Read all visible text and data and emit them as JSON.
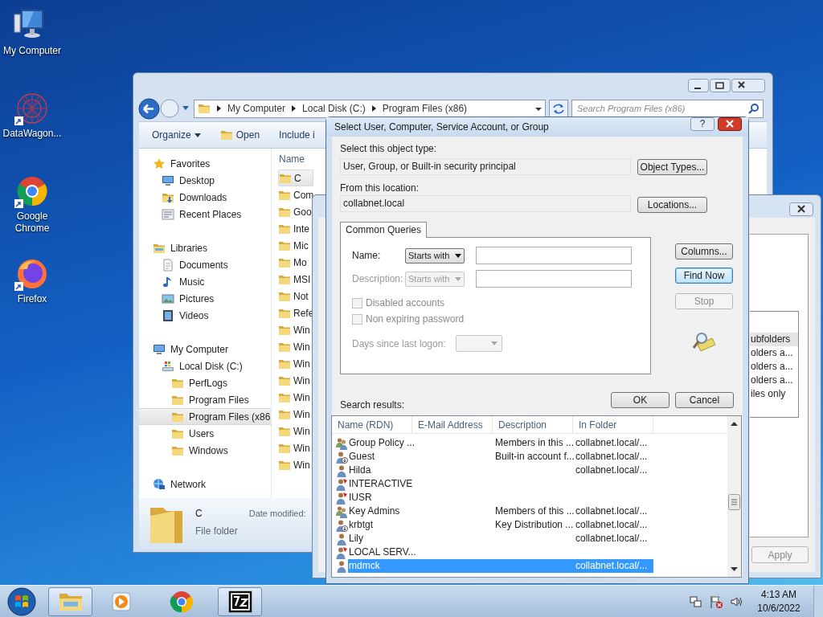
{
  "desktop_icons": [
    {
      "label": "My Computer",
      "kind": "computer"
    },
    {
      "label": "DataWagon...",
      "kind": "mesh"
    },
    {
      "label": "Google Chrome",
      "kind": "chrome"
    },
    {
      "label": "Firefox",
      "kind": "firefox"
    }
  ],
  "explorer": {
    "breadcrumbs": [
      "My Computer",
      "Local Disk (C:)",
      "Program Files (x86)"
    ],
    "search": {
      "placeholder": "Search Program Files (x86)"
    },
    "toolbar": [
      {
        "label": "Organize",
        "kind": "menu"
      },
      {
        "label": "Open",
        "kind": "open"
      },
      {
        "label": "Include i",
        "kind": "plain"
      }
    ],
    "nav": [
      {
        "label": "Favorites",
        "kind": "star",
        "selected": false,
        "children": [
          {
            "label": "Desktop",
            "kind": "desktop",
            "selected": false
          },
          {
            "label": "Downloads",
            "kind": "downloads",
            "selected": false
          },
          {
            "label": "Recent Places",
            "kind": "recent",
            "selected": false
          }
        ]
      },
      {
        "label": "Libraries",
        "kind": "libraries",
        "selected": false,
        "children": [
          {
            "label": "Documents",
            "kind": "documents",
            "selected": false
          },
          {
            "label": "Music",
            "kind": "music",
            "selected": false
          },
          {
            "label": "Pictures",
            "kind": "pictures",
            "selected": false
          },
          {
            "label": "Videos",
            "kind": "videos",
            "selected": false
          }
        ]
      },
      {
        "label": "My Computer",
        "kind": "computer",
        "selected": false,
        "children": [
          {
            "label": "Local Disk (C:)",
            "kind": "disk",
            "selected": false,
            "children": [
              {
                "label": "PerfLogs",
                "kind": "folder",
                "selected": false
              },
              {
                "label": "Program Files",
                "kind": "folder",
                "selected": false
              },
              {
                "label": "Program Files (x86",
                "kind": "folder",
                "selected": true
              },
              {
                "label": "Users",
                "kind": "folder",
                "selected": false
              },
              {
                "label": "Windows",
                "kind": "folder",
                "selected": false
              }
            ]
          }
        ]
      },
      {
        "label": "Network",
        "kind": "network",
        "selected": false
      }
    ],
    "column": "Name",
    "files": [
      {
        "name": "C",
        "selected": true
      },
      {
        "name": "Com",
        "selected": false
      },
      {
        "name": "Goo",
        "selected": false
      },
      {
        "name": "Inte",
        "selected": false
      },
      {
        "name": "Mic",
        "selected": false
      },
      {
        "name": "Mo",
        "selected": false
      },
      {
        "name": "MSI",
        "selected": false
      },
      {
        "name": "Not",
        "selected": false
      },
      {
        "name": "Refe",
        "selected": false
      },
      {
        "name": "Win",
        "selected": false
      },
      {
        "name": "Win",
        "selected": false
      },
      {
        "name": "Win",
        "selected": false
      },
      {
        "name": "Win",
        "selected": false
      },
      {
        "name": "Win",
        "selected": false
      },
      {
        "name": "Win",
        "selected": false
      },
      {
        "name": "Win",
        "selected": false
      },
      {
        "name": "Win",
        "selected": false
      },
      {
        "name": "Win",
        "selected": false
      }
    ],
    "details": {
      "name": "C",
      "type": "File folder",
      "date_label": "Date modified:"
    }
  },
  "back_dialog": {
    "list_items": [
      {
        "label": "ubfolders",
        "selected": true
      },
      {
        "label": "olders a...",
        "selected": false
      },
      {
        "label": "olders a...",
        "selected": false
      },
      {
        "label": "olders a...",
        "selected": false
      },
      {
        "label": "iles only",
        "selected": false
      }
    ],
    "apply": {
      "label": "Apply",
      "disabled": true
    }
  },
  "dialog": {
    "title": "Select User, Computer, Service Account, or Group",
    "help": "?",
    "object_type": {
      "label": "Select this object type:",
      "value": "User, Group, or Built-in security principal",
      "button": "Object Types..."
    },
    "location": {
      "label": "From this location:",
      "value": "collabnet.local",
      "button": "Locations..."
    },
    "tab": "Common Queries",
    "query_fields": [
      {
        "label": "Name:",
        "operator": "Starts with",
        "disabled": false
      },
      {
        "label": "Description:",
        "operator": "Starts with",
        "disabled": true
      }
    ],
    "checkboxes": [
      {
        "label": "Disabled accounts",
        "checked": false,
        "disabled": true
      },
      {
        "label": "Non expiring password",
        "checked": false,
        "disabled": true
      }
    ],
    "days": {
      "label": "Days since last logon:",
      "disabled": true
    },
    "side_buttons": [
      {
        "label": "Columns...",
        "default": false,
        "disabled": false
      },
      {
        "label": "Find Now",
        "default": true,
        "disabled": false
      },
      {
        "label": "Stop",
        "default": false,
        "disabled": true
      }
    ],
    "ok": "OK",
    "cancel": "Cancel",
    "results_label": "Search results:",
    "columns": [
      "Name (RDN)",
      "E-Mail Address",
      "Description",
      "In Folder"
    ],
    "rows": [
      {
        "name": "Group Policy ...",
        "description": "Members in this ...",
        "folder": "collabnet.local/...",
        "kind": "group",
        "selected": false
      },
      {
        "name": "Guest",
        "description": "Built-in account f...",
        "folder": "collabnet.local/...",
        "kind": "disabled-user",
        "selected": false
      },
      {
        "name": "Hilda",
        "folder": "collabnet.local/...",
        "kind": "user",
        "selected": false
      },
      {
        "name": "INTERACTIVE",
        "kind": "builtin",
        "selected": false
      },
      {
        "name": "IUSR",
        "kind": "builtin",
        "selected": false
      },
      {
        "name": "Key Admins",
        "description": "Members of this ...",
        "folder": "collabnet.local/...",
        "kind": "group",
        "selected": false
      },
      {
        "name": "krbtgt",
        "description": "Key Distribution ...",
        "folder": "collabnet.local/...",
        "kind": "disabled-user",
        "selected": false
      },
      {
        "name": "Lily",
        "folder": "collabnet.local/...",
        "kind": "user",
        "selected": false
      },
      {
        "name": "LOCAL SERV...",
        "kind": "builtin",
        "selected": false
      },
      {
        "name": "mdmck",
        "folder": "collabnet.local/...",
        "kind": "user",
        "selected": true
      }
    ]
  },
  "taskbar": {
    "apps": [
      {
        "kind": "explorer",
        "running": true
      },
      {
        "kind": "media",
        "running": false
      },
      {
        "kind": "chrome",
        "running": false
      },
      {
        "kind": "archiver",
        "running": true
      }
    ],
    "time": "4:13 AM",
    "date": "10/6/2022"
  }
}
